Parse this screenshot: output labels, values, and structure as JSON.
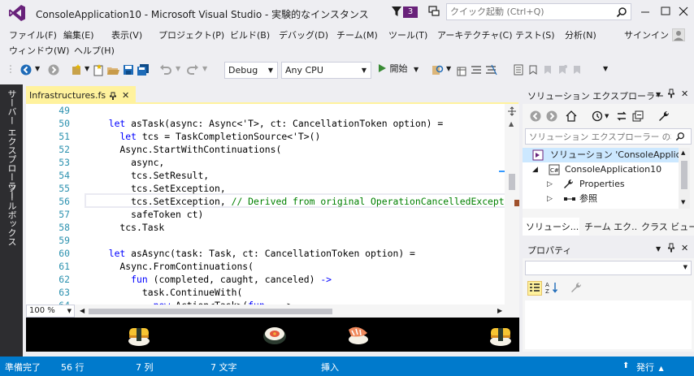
{
  "window": {
    "title": "ConsoleApplication10 - Microsoft Visual Studio - 実験的なインスタンス",
    "notification_count": "3",
    "quick_launch_placeholder": "クイック起動 (Ctrl+Q)"
  },
  "menu": {
    "row1": [
      "ファイル(F)",
      "編集(E)",
      "表示(V)",
      "プロジェクト(P)",
      "ビルド(B)",
      "デバッグ(D)",
      "チーム(M)",
      "ツール(T)",
      "アーキテクチャ(C)",
      "テスト(S)",
      "分析(N)"
    ],
    "row2": [
      "ウィンドウ(W)",
      "ヘルプ(H)"
    ],
    "signin": "サインイン"
  },
  "toolbar": {
    "config": "Debug",
    "platform": "Any CPU",
    "start": "開始"
  },
  "side_tabs": {
    "server_explorer": "サーバー エクスプローラー",
    "toolbox": "ツールボックス"
  },
  "editor": {
    "tab_label": "Infrastructures.fs",
    "zoom": "100 %",
    "lines": [
      {
        "n": "49",
        "segs": []
      },
      {
        "n": "50",
        "segs": [
          {
            "t": "  "
          },
          {
            "t": "let",
            "k": "kw"
          },
          {
            "t": " asTask(async: Async<'T>, ct: CancellationToken option) ="
          }
        ]
      },
      {
        "n": "51",
        "segs": [
          {
            "t": "    "
          },
          {
            "t": "let",
            "k": "kw"
          },
          {
            "t": " tcs = TaskCompletionSource<'T>()"
          }
        ]
      },
      {
        "n": "52",
        "segs": [
          {
            "t": "    Async.StartWithContinuations("
          }
        ]
      },
      {
        "n": "53",
        "segs": [
          {
            "t": "      async,"
          }
        ]
      },
      {
        "n": "54",
        "segs": [
          {
            "t": "      tcs.SetResult,"
          }
        ]
      },
      {
        "n": "55",
        "segs": [
          {
            "t": "      tcs.SetException,"
          }
        ]
      },
      {
        "n": "56",
        "segs": [
          {
            "t": "      tcs.SetException, "
          },
          {
            "t": "// Derived from original OperationCancelledExcepti",
            "k": "cm"
          }
        ]
      },
      {
        "n": "57",
        "segs": [
          {
            "t": "      safeToken ct)"
          }
        ]
      },
      {
        "n": "58",
        "segs": [
          {
            "t": "    tcs.Task"
          }
        ]
      },
      {
        "n": "59",
        "segs": []
      },
      {
        "n": "60",
        "segs": [
          {
            "t": "  "
          },
          {
            "t": "let",
            "k": "kw"
          },
          {
            "t": " asAsync(task: Task, ct: CancellationToken option) ="
          }
        ]
      },
      {
        "n": "61",
        "segs": [
          {
            "t": "    Async.FromContinuations("
          }
        ]
      },
      {
        "n": "62",
        "segs": [
          {
            "t": "      "
          },
          {
            "t": "fun",
            "k": "kw"
          },
          {
            "t": " (completed, caught, canceled) "
          },
          {
            "t": "->",
            "k": "kw"
          }
        ]
      },
      {
        "n": "63",
        "segs": [
          {
            "t": "        task.ContinueWith("
          }
        ]
      },
      {
        "n": "64",
        "segs": [
          {
            "t": "          "
          },
          {
            "t": "new",
            "k": "kw"
          },
          {
            "t": " Action<Task>("
          },
          {
            "t": "fun",
            "k": "kw"
          },
          {
            "t": " _ ->"
          }
        ]
      }
    ]
  },
  "solution_explorer": {
    "title": "ソリューション エクスプローラー",
    "search_placeholder": "ソリューション エクスプローラー の検索",
    "tree": [
      {
        "label": "ソリューション 'ConsoleApplicat"
      },
      {
        "label": "ConsoleApplication10"
      },
      {
        "label": "Properties"
      },
      {
        "label": "参照"
      }
    ],
    "bottom_tabs": [
      "ソリューシ...",
      "チーム エク...",
      "クラス ビュー"
    ]
  },
  "properties": {
    "title": "プロパティ"
  },
  "status": {
    "ready": "準備完了",
    "line": "56 行",
    "col": "7 列",
    "ch": "7 文字",
    "mode": "挿入",
    "publish": "発行"
  },
  "colors": {
    "accent": "#007ACC",
    "keyword": "#0000FF",
    "comment": "#008000",
    "line_number": "#2B91AF",
    "tab_highlight": "#FFF29D",
    "side_strip": "#2D2D30"
  }
}
